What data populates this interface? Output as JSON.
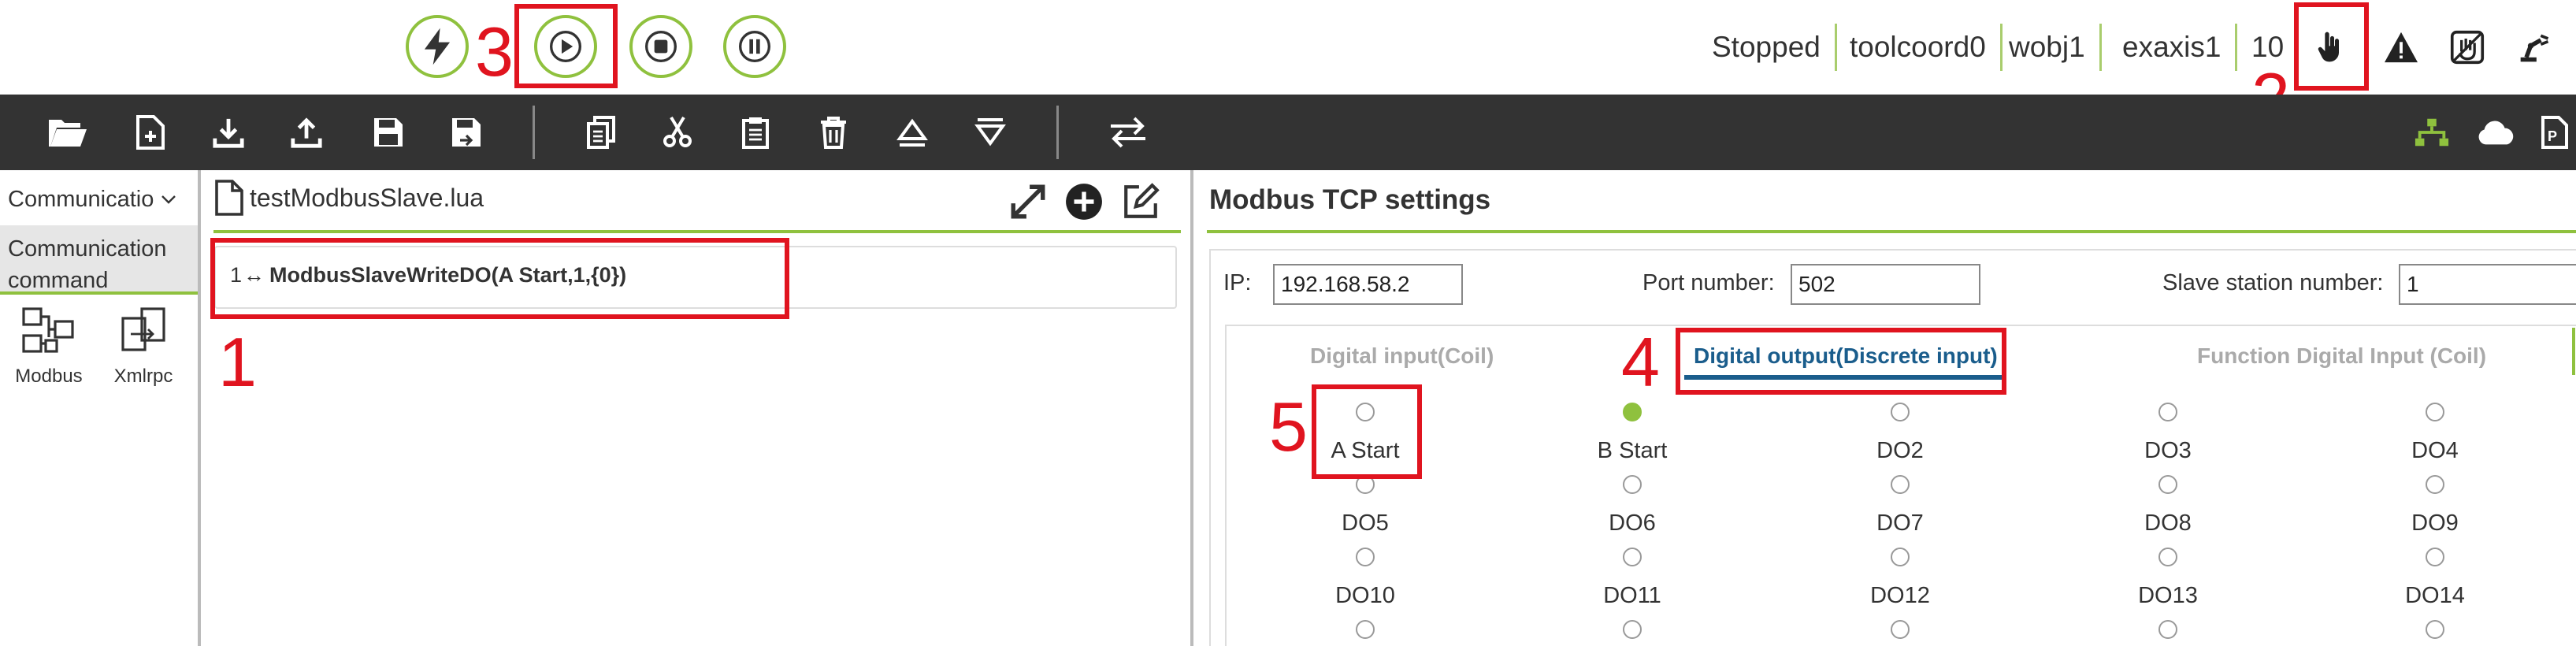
{
  "topbar": {
    "status": {
      "state": "Stopped",
      "tool": "toolcoord0",
      "wobj": "wobj1",
      "exaxis": "exaxis1",
      "speed": "10"
    },
    "icons": [
      "bolt-icon",
      "play-icon",
      "stop-icon",
      "pause-icon",
      "hand-icon",
      "warning-icon",
      "hand-guiding-icon",
      "robot-arm-icon"
    ]
  },
  "toolbar": {
    "icons": [
      "open-folder-icon",
      "new-file-icon",
      "download-icon",
      "upload-icon",
      "save-icon",
      "save-as-icon",
      "copy-icon",
      "cut-icon",
      "paste-icon",
      "delete-icon",
      "move-up-icon",
      "move-down-icon",
      "swap-icon",
      "network-icon",
      "cloud-icon",
      "document-icon"
    ]
  },
  "left": {
    "dropdown": "Communicatio",
    "category": "Communication command",
    "items": [
      {
        "label": "Modbus"
      },
      {
        "label": "Xmlrpc"
      }
    ]
  },
  "editor": {
    "filename": "testModbusSlave.lua",
    "lines": [
      {
        "num": "1",
        "arrow": "↔",
        "code": "ModbusSlaveWriteDO(A Start,1,{0})"
      }
    ]
  },
  "settings": {
    "title": "Modbus TCP settings",
    "ip_label": "IP:",
    "ip_value": "192.168.58.2",
    "port_label": "Port number:",
    "port_value": "502",
    "slave_label": "Slave station number:",
    "slave_value": "1",
    "tabs": [
      "Digital input(Coil)",
      "Digital output(Discrete input)",
      "Function Digital Input (Coil)"
    ],
    "active_tab": 1,
    "outputs": [
      {
        "label": "A Start",
        "on": false
      },
      {
        "label": "B Start",
        "on": true
      },
      {
        "label": "DO2",
        "on": false
      },
      {
        "label": "DO3",
        "on": false
      },
      {
        "label": "DO4",
        "on": false
      },
      {
        "label": "DO5",
        "on": false
      },
      {
        "label": "DO6",
        "on": false
      },
      {
        "label": "DO7",
        "on": false
      },
      {
        "label": "DO8",
        "on": false
      },
      {
        "label": "DO9",
        "on": false
      },
      {
        "label": "DO10",
        "on": false
      },
      {
        "label": "DO11",
        "on": false
      },
      {
        "label": "DO12",
        "on": false
      },
      {
        "label": "DO13",
        "on": false
      },
      {
        "label": "DO14",
        "on": false
      }
    ]
  },
  "annotations": [
    "1",
    "2",
    "3",
    "4",
    "5"
  ],
  "colors": {
    "accent": "#8fc13e",
    "annotation_red": "#e0141f",
    "toolbar_bg": "#333333",
    "tab_active": "#1a5d8c"
  }
}
